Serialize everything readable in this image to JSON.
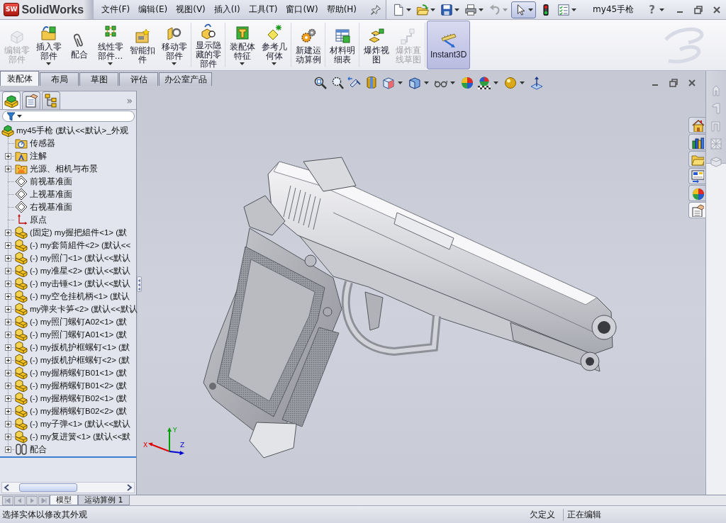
{
  "app": {
    "logo_badge": "SW",
    "logo_text": "SolidWorks",
    "document_title": "my45手枪",
    "help_label": "?"
  },
  "menu": [
    "文件(F)",
    "编辑(E)",
    "视图(V)",
    "插入(I)",
    "工具(T)",
    "窗口(W)",
    "帮助(H)"
  ],
  "quick_tools": [
    {
      "kind": "new",
      "dropdown": true,
      "disabled": false,
      "selected": false
    },
    {
      "kind": "open",
      "dropdown": true,
      "disabled": false,
      "selected": false
    },
    {
      "kind": "save",
      "dropdown": true,
      "disabled": false,
      "selected": false
    },
    {
      "kind": "print",
      "dropdown": true,
      "disabled": false,
      "selected": false
    },
    {
      "kind": "undo",
      "dropdown": true,
      "disabled": true,
      "selected": false
    },
    {
      "kind": "select",
      "dropdown": true,
      "disabled": false,
      "selected": true
    },
    {
      "kind": "rebuild",
      "dropdown": false,
      "disabled": false,
      "selected": false
    },
    {
      "kind": "options",
      "dropdown": true,
      "disabled": false,
      "selected": false
    }
  ],
  "command_groups": [
    [
      {
        "kind": "edit-component",
        "label": "编辑零部件",
        "dropdown": false,
        "disabled": true,
        "selected": false
      },
      {
        "kind": "insert-components",
        "label": "插入零部件",
        "dropdown": true,
        "disabled": false,
        "selected": false
      },
      {
        "kind": "mate",
        "label": "配合",
        "dropdown": false,
        "disabled": false,
        "selected": false
      },
      {
        "kind": "linear-pattern",
        "label": "线性零部件…",
        "dropdown": true,
        "disabled": false,
        "selected": false
      },
      {
        "kind": "smart-fasteners",
        "label": "智能扣件",
        "dropdown": false,
        "disabled": false,
        "selected": false
      },
      {
        "kind": "move-component",
        "label": "移动零部件",
        "dropdown": true,
        "disabled": false,
        "selected": false
      }
    ],
    [
      {
        "kind": "show-hidden",
        "label": "显示隐藏的零部件",
        "dropdown": false,
        "disabled": false,
        "selected": false
      }
    ],
    [
      {
        "kind": "assembly-features",
        "label": "装配体特征",
        "dropdown": true,
        "disabled": false,
        "selected": false
      },
      {
        "kind": "reference-geometry",
        "label": "参考几何体",
        "dropdown": true,
        "disabled": false,
        "selected": false
      }
    ],
    [
      {
        "kind": "motion-study",
        "label": "新建运动算例",
        "dropdown": false,
        "disabled": false,
        "selected": false
      }
    ],
    [
      {
        "kind": "bill-of-materials",
        "label": "材料明细表",
        "dropdown": false,
        "disabled": false,
        "selected": false
      }
    ],
    [
      {
        "kind": "exploded-view",
        "label": "爆炸视图",
        "dropdown": false,
        "disabled": false,
        "selected": false
      },
      {
        "kind": "explode-line-sketch",
        "label": "爆炸直线草图",
        "dropdown": false,
        "disabled": true,
        "selected": false
      }
    ],
    [
      {
        "kind": "instant3d",
        "label": "Instant3D",
        "dropdown": false,
        "disabled": false,
        "selected": true
      }
    ]
  ],
  "command_tabs": [
    {
      "label": "装配体",
      "selected": true
    },
    {
      "label": "布局",
      "selected": false
    },
    {
      "label": "草图",
      "selected": false
    },
    {
      "label": "评估",
      "selected": false
    },
    {
      "label": "办公室产品",
      "selected": false
    }
  ],
  "manager_tabs": [
    {
      "kind": "feature-manager",
      "selected": true
    },
    {
      "kind": "property-manager",
      "selected": false
    },
    {
      "kind": "configuration-manager",
      "selected": false
    }
  ],
  "manager_expand": "»",
  "tree": {
    "root": {
      "kind": "assembly",
      "label": "my45手枪 (默认<<默认>_外观",
      "children": [
        {
          "kind": "sensors",
          "label": "传感器",
          "expandable": false
        },
        {
          "kind": "annotations",
          "label": "注解",
          "expandable": true
        },
        {
          "kind": "lights",
          "label": "光源、相机与布景",
          "expandable": true
        },
        {
          "kind": "plane",
          "label": "前视基准面",
          "expandable": false
        },
        {
          "kind": "plane",
          "label": "上视基准面",
          "expandable": false
        },
        {
          "kind": "plane",
          "label": "右视基准面",
          "expandable": false
        },
        {
          "kind": "origin",
          "label": "原点",
          "expandable": false
        },
        {
          "kind": "part",
          "label": "(固定) my握把組件<1> (默",
          "expandable": true
        },
        {
          "kind": "part",
          "label": "(-) my套筒組件<2> (默认<<",
          "expandable": true
        },
        {
          "kind": "part",
          "label": "(-) my照门<1> (默认<<默认",
          "expandable": true
        },
        {
          "kind": "part",
          "label": "(-) my准星<2> (默认<<默认",
          "expandable": true
        },
        {
          "kind": "part",
          "label": "(-) my击锤<1> (默认<<默认",
          "expandable": true
        },
        {
          "kind": "part",
          "label": "(-) my空仓挂机柄<1> (默认",
          "expandable": true
        },
        {
          "kind": "part",
          "label": "my弹夹卡笋<2> (默认<<默认",
          "expandable": true
        },
        {
          "kind": "part",
          "label": "(-) my照门螺钉A02<1> (默",
          "expandable": true
        },
        {
          "kind": "part",
          "label": "(-) my照门螺钉A01<1> (默",
          "expandable": true
        },
        {
          "kind": "part",
          "label": "(-) my扳机护框螺钉<1> (默",
          "expandable": true
        },
        {
          "kind": "part",
          "label": "(-) my扳机护框螺钉<2> (默",
          "expandable": true
        },
        {
          "kind": "part",
          "label": "(-) my握柄螺钉B01<1> (默",
          "expandable": true
        },
        {
          "kind": "part",
          "label": "(-) my握柄螺钉B01<2> (默",
          "expandable": true
        },
        {
          "kind": "part",
          "label": "(-) my握柄螺钉B02<1> (默",
          "expandable": true
        },
        {
          "kind": "part",
          "label": "(-) my握柄螺钉B02<2> (默",
          "expandable": true
        },
        {
          "kind": "part",
          "label": "(-) my子弹<1> (默认<<默认",
          "expandable": true
        },
        {
          "kind": "part",
          "label": "(-) my复进簧<1> (默认<<默",
          "expandable": true
        },
        {
          "kind": "mates",
          "label": "配合",
          "expandable": true
        }
      ]
    }
  },
  "task_pane_tabs": [
    {
      "kind": "home",
      "selected": false
    },
    {
      "kind": "library",
      "selected": false
    },
    {
      "kind": "files",
      "selected": false
    },
    {
      "kind": "view-palette",
      "selected": false
    },
    {
      "kind": "appearances",
      "selected": false
    },
    {
      "kind": "custom-properties",
      "selected": true
    }
  ],
  "triad": {
    "axes": [
      {
        "label": "X",
        "color": "#e00000"
      },
      {
        "label": "Y",
        "color": "#00a000"
      },
      {
        "label": "Z",
        "color": "#0000d0"
      }
    ]
  },
  "bottom_tabs": [
    {
      "label": "模型",
      "selected": true
    },
    {
      "label": "运动算例 1",
      "selected": false
    }
  ],
  "status_bar": {
    "message": "选择实体以修改其外观",
    "fields": [
      "欠定义",
      "正在编辑"
    ]
  }
}
